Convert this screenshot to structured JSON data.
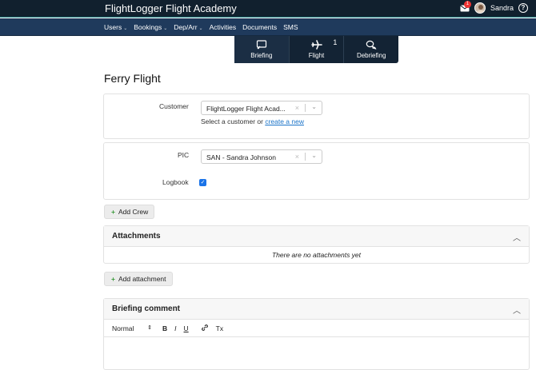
{
  "app": {
    "title": "FlightLogger Flight Academy",
    "user_name": "Sandra",
    "mail_count": "1",
    "help_glyph": "?"
  },
  "nav": {
    "items": [
      {
        "label": "Users",
        "dropdown": true
      },
      {
        "label": "Bookings",
        "dropdown": true
      },
      {
        "label": "Dep/Arr",
        "dropdown": true
      },
      {
        "label": "Activities",
        "dropdown": false
      },
      {
        "label": "Documents",
        "dropdown": false
      },
      {
        "label": "SMS",
        "dropdown": false
      }
    ],
    "caret": "⌄"
  },
  "stages": {
    "briefing": "Briefing",
    "flight": "Flight",
    "flight_count": "1",
    "debriefing": "Debriefing"
  },
  "page": {
    "title": "Ferry Flight"
  },
  "customer": {
    "label": "Customer",
    "value": "FlightLogger Flight Acad...",
    "helper_prefix": "Select a customer or ",
    "helper_link": "create a new"
  },
  "crew": {
    "pic_label": "PIC",
    "pic_value": "SAN - Sandra Johnson",
    "logbook_label": "Logbook",
    "add_crew": "Add Crew"
  },
  "attachments": {
    "title": "Attachments",
    "empty": "There are no attachments yet",
    "add": "Add attachment"
  },
  "briefing_comment": {
    "title": "Briefing comment",
    "format": "Normal",
    "bold": "B",
    "italic": "I",
    "underline": "U",
    "clear": "Tx"
  },
  "glyphs": {
    "clear_x": "×",
    "chevron": "⌄",
    "collapse": "︿",
    "plus": "+",
    "check": "✓",
    "updown": "⇕"
  }
}
